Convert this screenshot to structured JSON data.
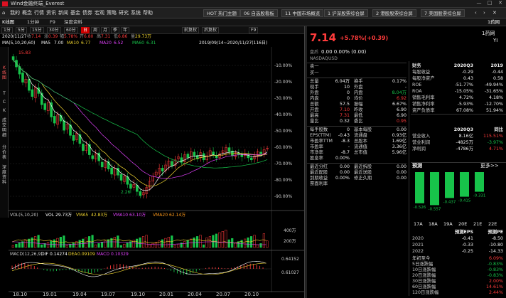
{
  "window": {
    "title": "Wind金融终端_Everest",
    "controls": [
      "—",
      "□",
      "✕"
    ]
  },
  "menu": {
    "items": [
      "我的",
      "概念",
      "行情",
      "资讯",
      "新闻",
      "基金",
      "债券",
      "宏观",
      "策略",
      "研究",
      "系统",
      "帮助"
    ],
    "tabs": [
      "HOT 热门主题",
      "06 自选股看板",
      "11 中国市场概览",
      "1 沪深股票综合屏",
      "2 港股股票综合屏",
      "7 美国股票综合屏"
    ]
  },
  "tabbar": {
    "tabs": [
      "K线图",
      "1分钟",
      "F9",
      "深度资料"
    ],
    "right": [
      "1药网"
    ]
  },
  "periods": [
    "1分",
    "5分",
    "15分",
    "30分",
    "60分",
    "日",
    "周",
    "月",
    "季",
    "年",
    "前复权",
    "后复权",
    "F9"
  ],
  "info": {
    "date": "2020/11/27",
    "items": [
      {
        "label": "收",
        "value": "7.14"
      },
      {
        "label": "涨",
        "value": "0.39"
      },
      {
        "label": "幅",
        "value": "5.78%"
      },
      {
        "label": "开",
        "value": "6.80"
      },
      {
        "label": "高",
        "value": "7.31"
      },
      {
        "label": "低",
        "value": "6.86"
      },
      {
        "label": "量",
        "value": "29.73万"
      }
    ],
    "range": "2019/09/14~2020/11/27(116日)"
  },
  "ma": {
    "label": "MA(5,10,20,60)",
    "items": [
      {
        "name": "MA5",
        "value": "7.00"
      },
      {
        "name": "MA10",
        "value": "6.77"
      },
      {
        "name": "MA20",
        "value": "6.52"
      },
      {
        "name": "MA60",
        "value": "6.31"
      }
    ]
  },
  "side_tabs": [
    "K线图",
    "T",
    "C",
    "K",
    "成交明细",
    "分价表",
    "深度资料"
  ],
  "chart_data": {
    "type": "line",
    "title": "1药网 YI 日K线",
    "y_axis_labels": [
      "-10.00%",
      "-20.00%",
      "-30.00%",
      "-40.00%",
      "-50.00%",
      "-60.00%",
      "-70.00%",
      "-80.00%",
      "-90.00%"
    ],
    "x_labels": [
      "18.10",
      "19.01",
      "19.04",
      "19.07",
      "19.10",
      "20.01",
      "20.04",
      "20.07",
      "20.10"
    ],
    "high_label": "15.83",
    "low_label": "2.26",
    "close": [
      15.8,
      15.1,
      14.4,
      13.6,
      13.9,
      12.8,
      12.2,
      13.1,
      12.5,
      11.4,
      10.9,
      11.6,
      10.2,
      9.6,
      10.4,
      9.8,
      8.9,
      9.5,
      8.4,
      7.9,
      8.6,
      7.6,
      6.9,
      7.4,
      6.5,
      6.1,
      6.6,
      5.9,
      5.3,
      5.8,
      5.1,
      4.6,
      5.2,
      4.5,
      4.0,
      4.4,
      3.6,
      3.2,
      3.6,
      2.9,
      2.5,
      2.8,
      3.3,
      3.9,
      4.4,
      4.8,
      5.2,
      4.9,
      5.5,
      5.9,
      5.4,
      6.0,
      6.3,
      5.8,
      6.5,
      6.2,
      6.8,
      6.4,
      6.1,
      6.7,
      6.0,
      6.4,
      6.9,
      6.5,
      6.2,
      6.6,
      6.9,
      7.2,
      6.8,
      6.4,
      6.7,
      6.5,
      6.3,
      6.6,
      6.2,
      6.0,
      6.4,
      6.8,
      6.6,
      7.0,
      7.14
    ],
    "volume_panel": {
      "label": "VOL(5,10,20)",
      "items": [
        {
          "name": "VOL",
          "value": "29.73万"
        },
        {
          "name": "VMA5",
          "value": "42.83万"
        },
        {
          "name": "VMA10",
          "value": "63.10万"
        },
        {
          "name": "VMA20",
          "value": "62.14万"
        }
      ],
      "axis_labels": [
        "400万",
        "200万"
      ]
    },
    "macd_panel": {
      "label": "MACD(12,26,9)",
      "items": [
        {
          "name": "DIF",
          "value": "0.14274"
        },
        {
          "name": "DEA",
          "value": "0.09109"
        },
        {
          "name": "MACD",
          "value": "0.10329"
        }
      ],
      "axis_labels": [
        "0.64152",
        "0.61027"
      ]
    }
  },
  "quote": {
    "price": "7.14",
    "change": "+5.78%(+0.39)",
    "name": "1药网",
    "code": "YI",
    "exchange": "NASDAQ",
    "currency": "USD",
    "sub_line": "0.00 0.00% (0.00)",
    "sub_label": "盘后",
    "bid_ask": [
      {
        "label": "卖一",
        "price": "",
        "vol": ""
      },
      {
        "label": "买一",
        "price": "",
        "vol": ""
      }
    ],
    "stats_left": [
      {
        "label": "总量",
        "value": "6.04万",
        "label2": "换手",
        "value2": "0.17%"
      },
      {
        "label": "现手",
        "value": "10",
        "label2": "外盘",
        "value2": "-"
      },
      {
        "label": "外盘",
        "value": "0",
        "label2": "内盘",
        "value2": "8.04万"
      },
      {
        "label": "内盘",
        "value": "0",
        "label2": "均价",
        "value2": "6.92"
      },
      {
        "label": "总额",
        "value": "57.5",
        "label2": "振幅",
        "value2": "6.67%"
      },
      {
        "label": "开盘",
        "value": "7.10",
        "label2": "昨收",
        "value2": "6.90"
      },
      {
        "label": "最高",
        "value": "7.31",
        "label2": "最低",
        "value2": "6.90"
      },
      {
        "label": "量比",
        "value": "0.32",
        "label2": "委比",
        "value2": "0.95"
      }
    ],
    "stats_left2": [
      {
        "label": "每手股数",
        "value": "0",
        "label2": "基本每股",
        "value2": "0.00"
      },
      {
        "label": "EPS(TTM)",
        "value": "-0.43",
        "label2": "流通盘",
        "value2": "0.93亿"
      },
      {
        "label": "市盈率TTM",
        "value": "-8.3",
        "label2": "总股本",
        "value2": "1.69亿"
      },
      {
        "label": "市盈率",
        "value": "-",
        "label2": "流通值",
        "value2": "3.36亿"
      },
      {
        "label": "市净率",
        "value": "-8.7",
        "label2": "总市值",
        "value2": "5.96亿"
      },
      {
        "label": "股息率",
        "value": "0.00%",
        "label2": "",
        "value2": ""
      }
    ],
    "stats_left3": [
      {
        "label": "最近分红",
        "value": "0.00",
        "label2": "最近拆股",
        "value2": "0.00"
      },
      {
        "label": "最近配股",
        "value": "0.00",
        "label2": "最近送股",
        "value2": "0.00"
      },
      {
        "label": "到期收益",
        "value": "0.00%",
        "label2": "修正久期",
        "value2": "0.00"
      },
      {
        "label": "票面利率",
        "value": "",
        "label2": "",
        "value2": ""
      }
    ],
    "fin_header": {
      "label": "财务",
      "c1": "2020Q3",
      "c2": "2019"
    },
    "fin_rows": [
      {
        "label": "每股收益",
        "c1": "-0.29",
        "c2": "-0.44"
      },
      {
        "label": "每股净资产",
        "c1": "0.43",
        "c2": "0.58"
      },
      {
        "label": "ROE",
        "c1": "-51.77%",
        "c2": "-49.94%"
      },
      {
        "label": "ROA",
        "c1": "-15.05%",
        "c2": "-31.65%"
      },
      {
        "label": "销售毛利率",
        "c1": "4.72%",
        "c2": "4.18%"
      },
      {
        "label": "销售净利率",
        "c1": "-5.93%",
        "c2": "-12.70%"
      },
      {
        "label": "资产负债率",
        "c1": "67.08%",
        "c2": "51.94%"
      }
    ],
    "growth_header": {
      "label": "",
      "c1": "2020Q3",
      "c2": "同比"
    },
    "growth_rows": [
      {
        "label": "营业收入",
        "c1": "8.16亿",
        "c2": "115.51%"
      },
      {
        "label": "营业利润",
        "c1": "-4825万",
        "c2": "-3.97%"
      },
      {
        "label": "净利润",
        "c1": "-4786万",
        "c2": "4.71%"
      }
    ],
    "forecast_title": "预测",
    "more": "更多>>",
    "eps_bars": {
      "labels": [
        "17A",
        "18A",
        "19A",
        "20E",
        "21E",
        "22E"
      ],
      "values": [
        -0.526,
        -0.557,
        -0.437,
        -0.415,
        -0.331,
        null
      ]
    },
    "eps_table_header": {
      "label": "",
      "c1": "预测EPS",
      "c2": "预测PE"
    },
    "eps_table": [
      {
        "label": "2020",
        "c1": "-0.41",
        "c2": "-8.50"
      },
      {
        "label": "2021",
        "c1": "-0.33",
        "c2": "-10.80"
      },
      {
        "label": "2022",
        "c1": "-0.25",
        "c2": "-14.33"
      }
    ],
    "returns": [
      {
        "label": "年初至今",
        "value": "6.09%"
      },
      {
        "label": "5日涨跌幅",
        "value": "-0.83%"
      },
      {
        "label": "10日涨跌幅",
        "value": "-0.83%"
      },
      {
        "label": "20日涨跌幅",
        "value": "-0.83%"
      },
      {
        "label": "30日涨跌幅",
        "value": "2.00%"
      },
      {
        "label": "60日涨跌幅",
        "value": "14.61%"
      },
      {
        "label": "120日涨跌幅",
        "value": "2.44%"
      }
    ]
  },
  "colors": {
    "up": "#ff3b3b",
    "down": "#17c34a",
    "ma5": "#ffffff",
    "ma10": "#f2d630",
    "ma20": "#e040fb",
    "ma60": "#17c34a"
  }
}
